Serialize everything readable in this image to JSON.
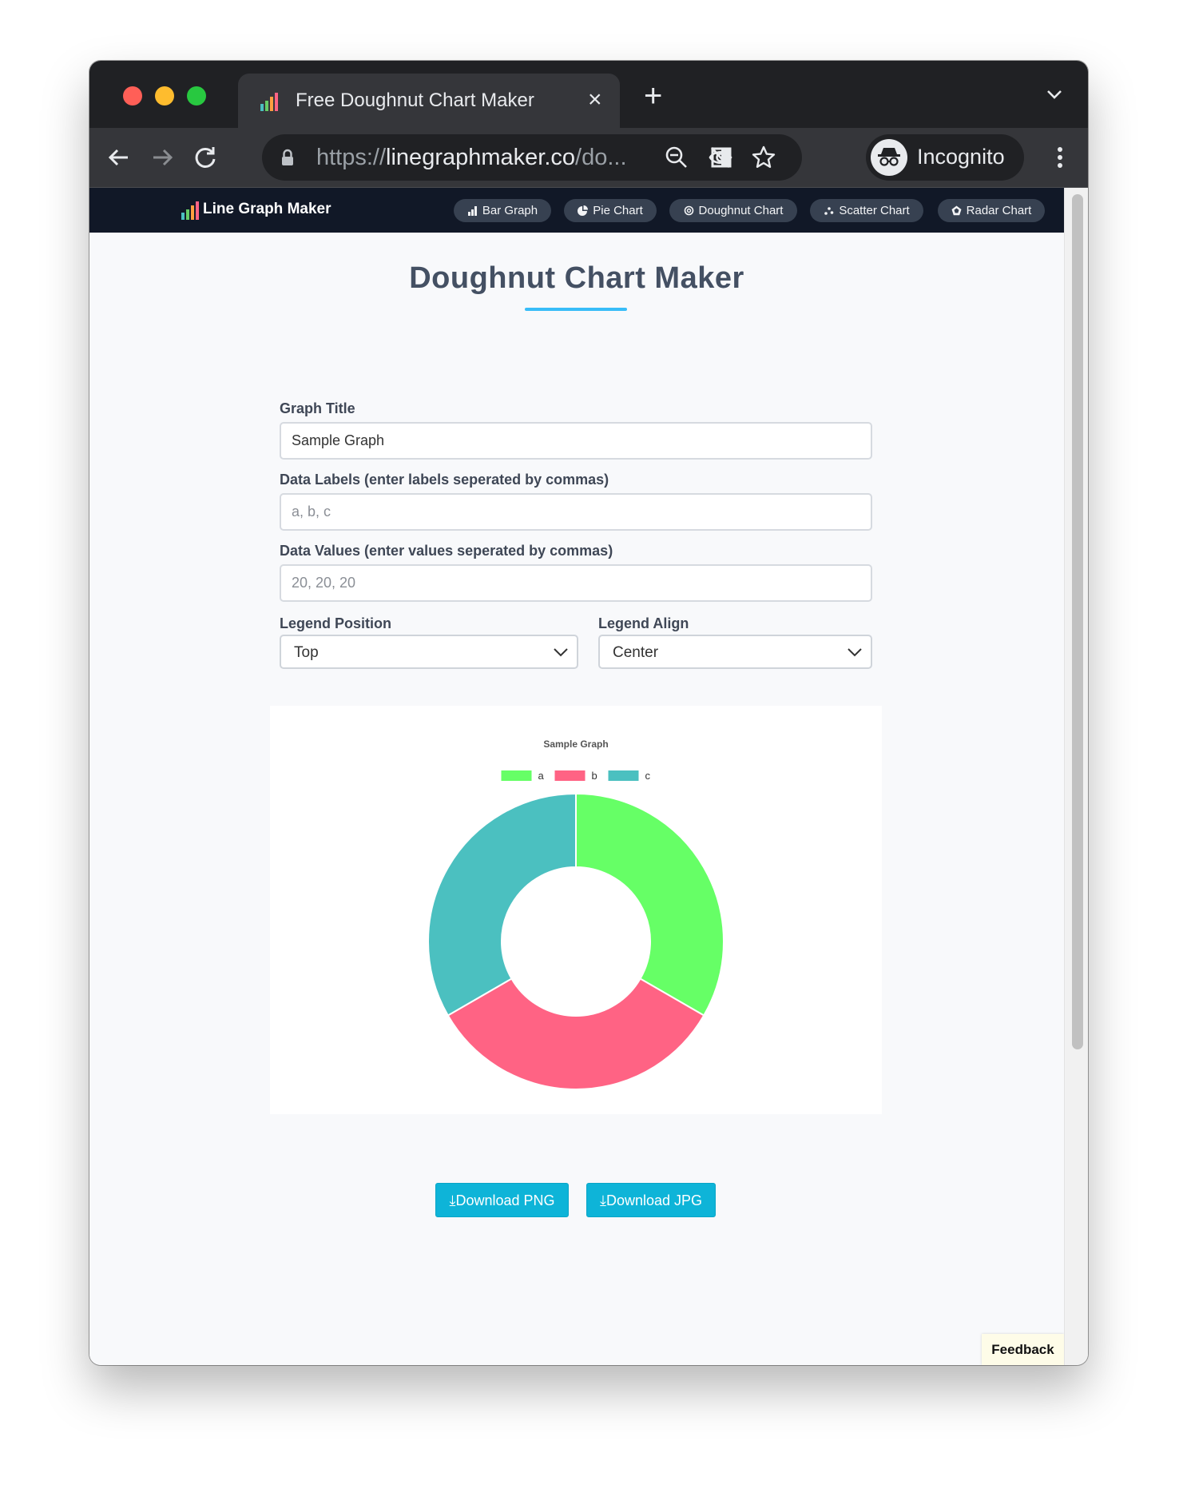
{
  "browser": {
    "tab_title": "Free Doughnut Chart Maker",
    "url_scheme": "https://",
    "url_host": "linegraphmaker.co",
    "url_path": "/do...",
    "profile_label": "Incognito"
  },
  "site": {
    "brand": "Line Graph Maker",
    "nav": [
      {
        "label": "Bar Graph",
        "icon": "bar-chart-icon"
      },
      {
        "label": "Pie Chart",
        "icon": "pie-chart-icon"
      },
      {
        "label": "Doughnut Chart",
        "icon": "doughnut-chart-icon"
      },
      {
        "label": "Scatter Chart",
        "icon": "scatter-chart-icon"
      },
      {
        "label": "Radar Chart",
        "icon": "radar-chart-icon"
      }
    ]
  },
  "main": {
    "title": "Doughnut Chart Maker",
    "graph_title_label": "Graph Title",
    "graph_title_value": "Sample Graph",
    "data_labels_label": "Data Labels (enter labels seperated by commas)",
    "data_labels_placeholder": "a, b, c",
    "data_values_label": "Data Values (enter values seperated by commas)",
    "data_values_placeholder": "20, 20, 20",
    "legend_position_label": "Legend Position",
    "legend_position_value": "Top",
    "legend_align_label": "Legend Align",
    "legend_align_value": "Center",
    "download_png": "Download PNG",
    "download_jpg": "Download JPG"
  },
  "feedback": "Feedback",
  "colors": {
    "accent": "#38bdf8",
    "button": "#0eb4d8",
    "nav_bg": "#111827",
    "slice_a": "#66ff66",
    "slice_b": "#ff6384",
    "slice_c": "#4bc0c0"
  },
  "chart_data": {
    "type": "doughnut",
    "title": "Sample Graph",
    "categories": [
      "a",
      "b",
      "c"
    ],
    "values": [
      20,
      20,
      20
    ],
    "colors": [
      "#66ff66",
      "#ff6384",
      "#4bc0c0"
    ],
    "legend": "top-center"
  }
}
